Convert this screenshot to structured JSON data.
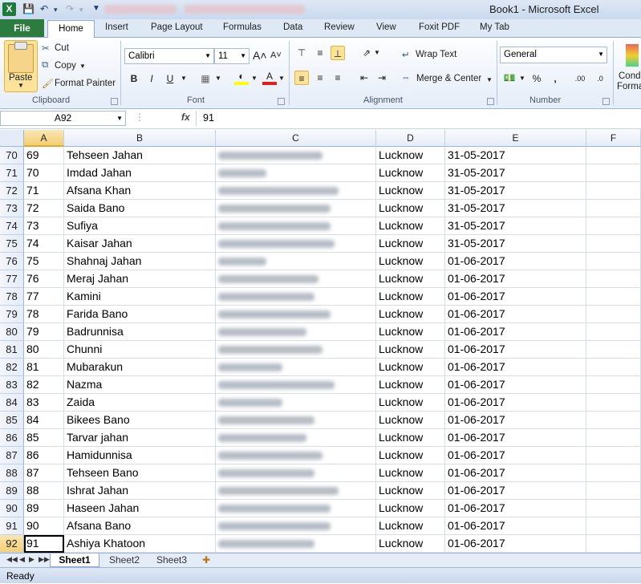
{
  "window": {
    "title": "Book1  -  Microsoft Excel"
  },
  "ribbon": {
    "tabs": [
      "File",
      "Home",
      "Insert",
      "Page Layout",
      "Formulas",
      "Data",
      "Review",
      "View",
      "Foxit PDF",
      "My Tab"
    ],
    "active_tab": "Home",
    "clipboard": {
      "paste": "Paste",
      "cut": "Cut",
      "copy": "Copy",
      "format_painter": "Format Painter",
      "label": "Clipboard"
    },
    "font": {
      "name": "Calibri",
      "size": "11",
      "label": "Font"
    },
    "alignment": {
      "wrap_text": "Wrap Text",
      "merge_center": "Merge & Center",
      "label": "Alignment"
    },
    "number": {
      "format": "General",
      "label": "Number"
    },
    "styles": {
      "cond_format_line1": "Cond",
      "cond_format_line2": "Forma"
    }
  },
  "formula_bar": {
    "name_box": "A92",
    "fx": "fx",
    "value": "91"
  },
  "columns": [
    "A",
    "B",
    "C",
    "D",
    "E",
    "F"
  ],
  "rows": [
    {
      "row": "70",
      "a": "69",
      "b": "Tehseen Jahan",
      "d": "Lucknow",
      "e": "31-05-2017"
    },
    {
      "row": "71",
      "a": "70",
      "b": "Imdad Jahan",
      "d": "Lucknow",
      "e": "31-05-2017"
    },
    {
      "row": "72",
      "a": "71",
      "b": "Afsana Khan",
      "d": "Lucknow",
      "e": "31-05-2017"
    },
    {
      "row": "73",
      "a": "72",
      "b": "Saida Bano",
      "d": "Lucknow",
      "e": "31-05-2017"
    },
    {
      "row": "74",
      "a": "73",
      "b": "Sufiya",
      "d": "Lucknow",
      "e": "31-05-2017"
    },
    {
      "row": "75",
      "a": "74",
      "b": "Kaisar Jahan",
      "d": "Lucknow",
      "e": "31-05-2017"
    },
    {
      "row": "76",
      "a": "75",
      "b": "Shahnaj Jahan",
      "d": "Lucknow",
      "e": "01-06-2017"
    },
    {
      "row": "77",
      "a": "76",
      "b": "Meraj Jahan",
      "d": "Lucknow",
      "e": "01-06-2017"
    },
    {
      "row": "78",
      "a": "77",
      "b": "Kamini",
      "d": "Lucknow",
      "e": "01-06-2017"
    },
    {
      "row": "79",
      "a": "78",
      "b": "Farida Bano",
      "d": "Lucknow",
      "e": "01-06-2017"
    },
    {
      "row": "80",
      "a": "79",
      "b": "Badrunnisa",
      "d": "Lucknow",
      "e": "01-06-2017"
    },
    {
      "row": "81",
      "a": "80",
      "b": "Chunni",
      "d": "Lucknow",
      "e": "01-06-2017"
    },
    {
      "row": "82",
      "a": "81",
      "b": "Mubarakun",
      "d": "Lucknow",
      "e": "01-06-2017"
    },
    {
      "row": "83",
      "a": "82",
      "b": "Nazma",
      "d": "Lucknow",
      "e": "01-06-2017"
    },
    {
      "row": "84",
      "a": "83",
      "b": "Zaida",
      "d": "Lucknow",
      "e": "01-06-2017"
    },
    {
      "row": "85",
      "a": "84",
      "b": "Bikees Bano",
      "d": "Lucknow",
      "e": "01-06-2017"
    },
    {
      "row": "86",
      "a": "85",
      "b": "Tarvar jahan",
      "d": "Lucknow",
      "e": "01-06-2017"
    },
    {
      "row": "87",
      "a": "86",
      "b": "Hamidunnisa",
      "d": "Lucknow",
      "e": "01-06-2017"
    },
    {
      "row": "88",
      "a": "87",
      "b": "Tehseen Bano",
      "d": "Lucknow",
      "e": "01-06-2017"
    },
    {
      "row": "89",
      "a": "88",
      "b": "Ishrat Jahan",
      "d": "Lucknow",
      "e": "01-06-2017"
    },
    {
      "row": "90",
      "a": "89",
      "b": "Haseen Jahan",
      "d": "Lucknow",
      "e": "01-06-2017"
    },
    {
      "row": "91",
      "a": "90",
      "b": "Afsana Bano",
      "d": "Lucknow",
      "e": "01-06-2017"
    },
    {
      "row": "92",
      "a": "91",
      "b": "Ashiya Khatoon",
      "d": "Lucknow",
      "e": "01-06-2017"
    }
  ],
  "active_row": "92",
  "active_column": "A",
  "sheets": [
    "Sheet1",
    "Sheet2",
    "Sheet3"
  ],
  "active_sheet": "Sheet1",
  "status": "Ready",
  "colors": {
    "accent": "#2d7c3f",
    "selection": "#f4cf74"
  }
}
